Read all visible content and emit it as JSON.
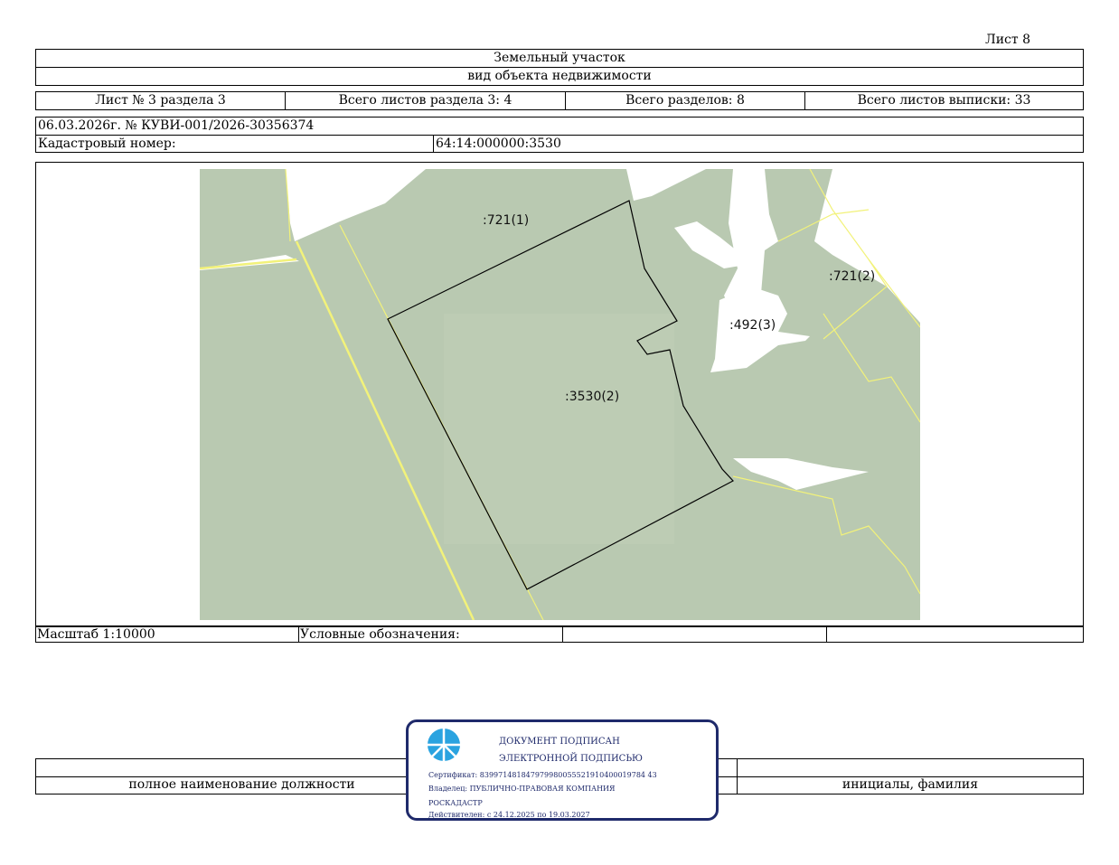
{
  "header": {
    "sheet_label": "Лист 8",
    "object_type": "Земельный участок",
    "object_kind": "вид объекта недвижимости",
    "sheet_of_section": "Лист № 3 раздела 3",
    "total_section_sheets": "Всего листов раздела 3: 4",
    "total_sections": "Всего разделов: 8",
    "total_extract_sheets": "Всего листов выписки: 33",
    "doc_ref": "06.03.2026г. № КУВИ-001/2026-30356374",
    "cadastral_label": "Кадастровый номер:",
    "cadastral_value": "64:14:000000:3530"
  },
  "map": {
    "labels": {
      "parcel_721_1": ":721(1)",
      "parcel_721_2": ":721(2)",
      "parcel_492_3": ":492(3)",
      "parcel_3530_2": ":3530(2)"
    },
    "colors": {
      "land": "#b9c9b1",
      "boundary_yellow": "#f2f27a",
      "subject_border": "#000000",
      "gap": "#ffffff"
    }
  },
  "legend": {
    "scale": "Масштаб 1:10000",
    "legend_label": "Условные обозначения:"
  },
  "signature": {
    "position_caption": "полное наименование должности",
    "name_caption": "инициалы, фамилия"
  },
  "stamp": {
    "line1": "ДОКУМЕНТ ПОДПИСАН",
    "line2": "ЭЛЕКТРОННОЙ ПОДПИСЬЮ",
    "certificate": "Сертификат: 839971481847979980055521910400019784 43",
    "owner": "Владелец: ПУБЛИЧНО-ПРАВОВАЯ КОМПАНИЯ",
    "owner2": "РОСКАДАСТР",
    "validity": "Действителен: с 24.12.2025 по 19.03.2027",
    "color": "#1f2a6b"
  }
}
